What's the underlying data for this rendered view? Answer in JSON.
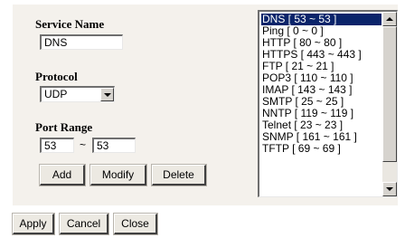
{
  "form": {
    "service_name_label": "Service Name",
    "service_name_value": "DNS",
    "protocol_label": "Protocol",
    "protocol_value": "UDP",
    "port_range_label": "Port Range",
    "port_start": "53",
    "port_separator": "~",
    "port_end": "53"
  },
  "form_buttons": {
    "add": "Add",
    "modify": "Modify",
    "delete": "Delete"
  },
  "services_list": {
    "selected_index": 0,
    "items": [
      "DNS [ 53 ~ 53 ]",
      "Ping [ 0 ~ 0 ]",
      "HTTP [ 80 ~ 80 ]",
      "HTTPS [ 443 ~ 443 ]",
      "FTP [ 21 ~ 21 ]",
      "POP3 [ 110 ~ 110 ]",
      "IMAP [ 143 ~ 143 ]",
      "SMTP [ 25 ~ 25 ]",
      "NNTP [ 119 ~ 119 ]",
      "Telnet [ 23 ~ 23 ]",
      "SNMP [ 161 ~ 161 ]",
      "TFTP [ 69 ~ 69 ]"
    ]
  },
  "footer_buttons": {
    "apply": "Apply",
    "cancel": "Cancel",
    "close": "Close"
  }
}
